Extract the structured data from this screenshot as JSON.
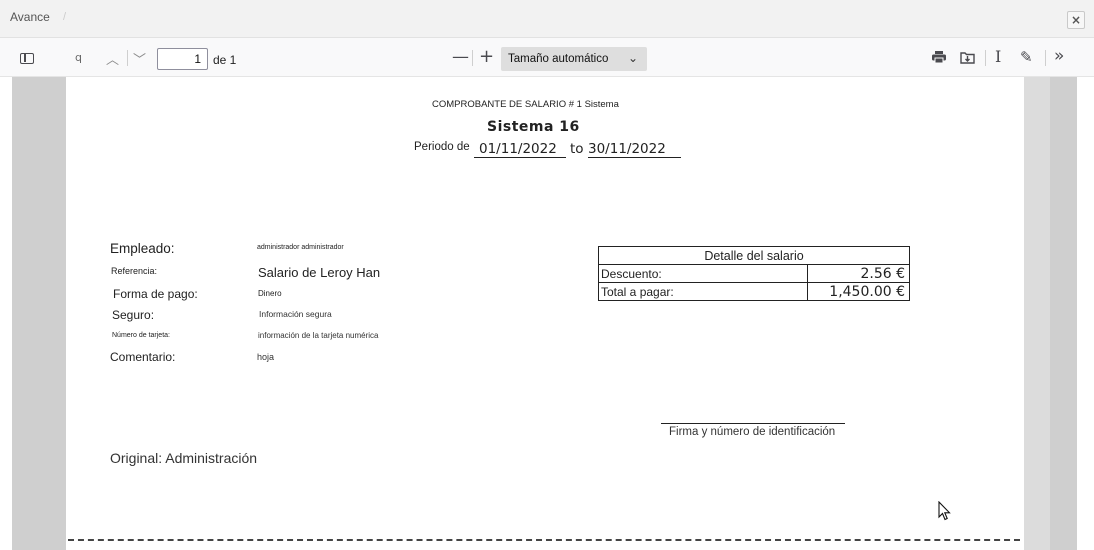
{
  "dialog": {
    "title": "Avance",
    "close_label": "×"
  },
  "toolbar": {
    "search_glyph": "q",
    "prev_glyph": "︿",
    "next_glyph": "﹀",
    "page_number": "1",
    "page_of": "de 1",
    "zoom_out_glyph": "—",
    "zoom_in_glyph": "+",
    "zoom_value": "Tamaño automático",
    "zoom_arrow": "⌄",
    "text_glyph": "I",
    "draw_glyph": "✎",
    "more_glyph": "»"
  },
  "document": {
    "heading": "COMPROBANTE DE SALARIO # 1 Sistema",
    "company": "Sistema 16",
    "period_label": "Periodo de",
    "period_from": "01/11/2022",
    "period_to_word": "to",
    "period_until": "30/11/2022",
    "fields": {
      "employee_label": "Empleado:",
      "employee_value": "administrador administrador",
      "reference_label": "Referencia:",
      "reference_value": "Salario de Leroy Han",
      "payment_label": "Forma de pago:",
      "payment_value": "Dinero",
      "insurance_label": "Seguro:",
      "insurance_value": "Información segura",
      "card_label": "Número de tarjeta:",
      "card_value": "información de la tarjeta numérica",
      "comment_label": "Comentario:",
      "comment_value": "hoja"
    },
    "salary_detail": {
      "title": "Detalle del salario",
      "rows": [
        {
          "label": "Descuento:",
          "value": "2.56 €"
        },
        {
          "label": "Total a pagar:",
          "value": "1,450.00 €"
        }
      ]
    },
    "signature_label": "Firma y número de identificación",
    "copy_label": "Original: Administración"
  }
}
